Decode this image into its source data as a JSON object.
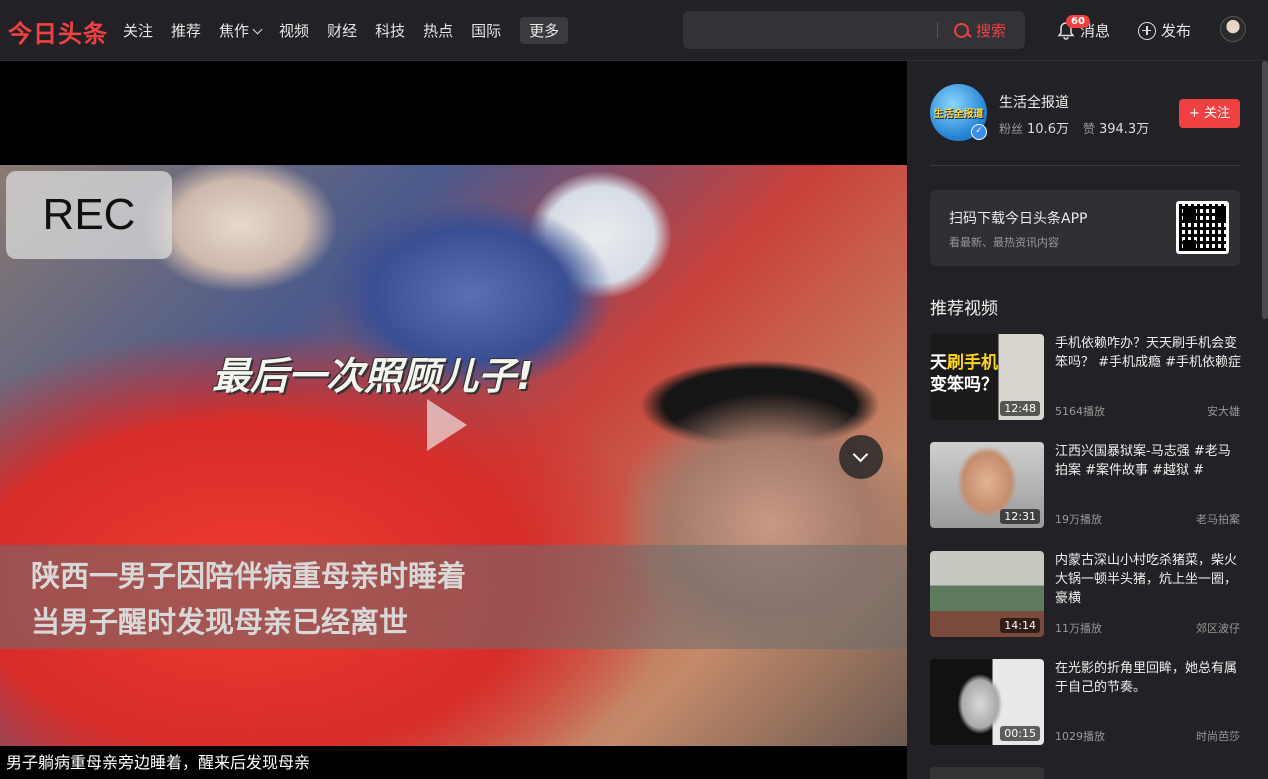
{
  "header": {
    "logo": "今日头条",
    "nav": [
      "关注",
      "推荐",
      "焦作",
      "视频",
      "财经",
      "科技",
      "热点",
      "国际"
    ],
    "nav_more": "更多",
    "search_placeholder": "",
    "search_button": "搜索",
    "message_label": "消息",
    "message_badge": "60",
    "publish_label": "发布",
    "accent_color": "#f04142"
  },
  "player": {
    "rec_label": "REC",
    "caption_top": "最后一次照顾儿子!",
    "subtitle_line1": "陕西一男子因陪伴病重母亲时睡着",
    "subtitle_line2": "当男子醒时发现母亲已经离世",
    "description": "男子躺病重母亲旁边睡着，醒来后发现母亲"
  },
  "author": {
    "name": "生活全报道",
    "avatar_text": "生活全报道",
    "fans_label": "粉丝",
    "fans_value": "10.6万",
    "likes_label": "赞",
    "likes_value": "394.3万",
    "follow_label": "+ 关注"
  },
  "app_promo": {
    "title": "扫码下载今日头条APP",
    "subtitle": "看最新、最热资讯内容"
  },
  "recommend": {
    "title": "推荐视频",
    "items": [
      {
        "title": "手机依赖咋办？天天刷手机会变笨吗？ #手机成瘾 #手机依赖症",
        "plays": "5164播放",
        "author": "安大雄",
        "duration": "12:48",
        "thumb_text_a": "天",
        "thumb_text_b": "刷手机",
        "thumb_text_c": "变笨吗？"
      },
      {
        "title": "江西兴国暴狱案-马志强 #老马拍案 #案件故事 #越狱 #",
        "plays": "19万播放",
        "author": "老马拍案",
        "duration": "12:31"
      },
      {
        "title": "内蒙古深山小村吃杀猪菜，柴火大锅一顿半头猪，炕上坐一圈，豪横",
        "plays": "11万播放",
        "author": "郊区波仔",
        "duration": "14:14"
      },
      {
        "title": "在光影的折角里回眸，她总有属于自己的节奏。",
        "plays": "1029播放",
        "author": "时尚芭莎",
        "duration": "00:15"
      }
    ]
  }
}
